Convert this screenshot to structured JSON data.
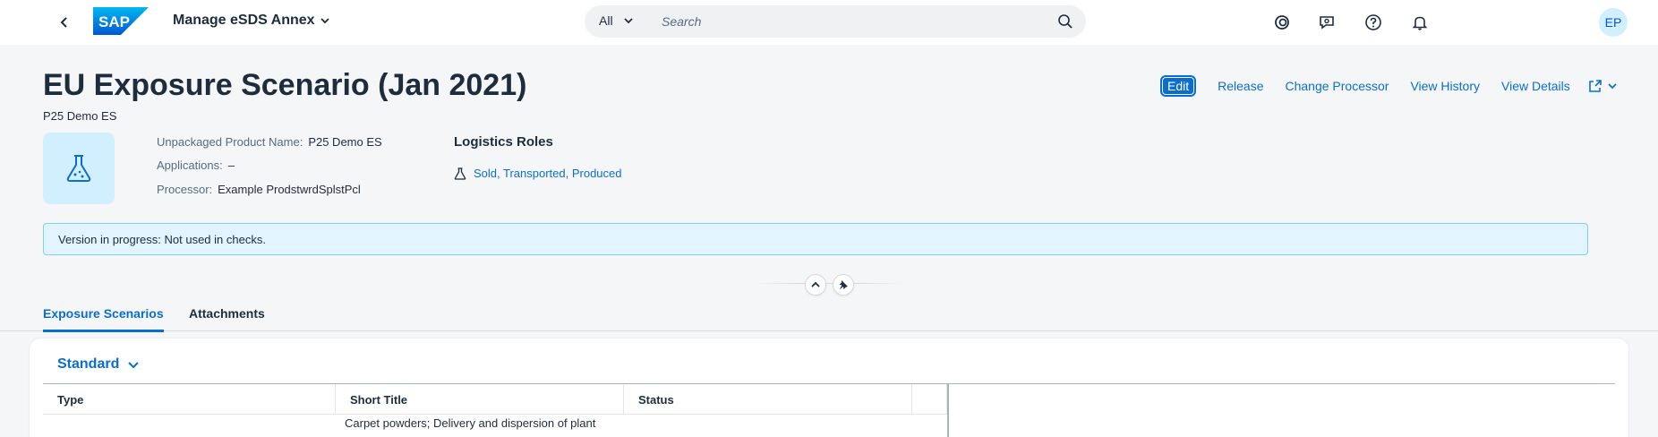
{
  "shell": {
    "app_title": "Manage eSDS Annex",
    "search_scope": "All",
    "search_placeholder": "Search",
    "avatar_initials": "EP"
  },
  "header": {
    "title": "EU Exposure Scenario (Jan 2021)",
    "subtitle": "P25 Demo ES",
    "actions": {
      "edit": "Edit",
      "release": "Release",
      "change_processor": "Change Processor",
      "view_history": "View History",
      "view_details": "View Details"
    },
    "attributes": [
      {
        "label": "Unpackaged Product Name:",
        "value": "P25 Demo ES"
      },
      {
        "label": "Applications:",
        "value": "–"
      },
      {
        "label": "Processor:",
        "value": "Example ProdstwrdSplstPcl"
      }
    ],
    "logistics_roles": {
      "title": "Logistics Roles",
      "value": "Sold, Transported, Produced"
    },
    "info_strip": "Version in progress: Not used in checks."
  },
  "tabs": [
    {
      "label": "Exposure Scenarios",
      "active": true
    },
    {
      "label": "Attachments",
      "active": false
    }
  ],
  "table": {
    "variant": "Standard",
    "columns": [
      "Type",
      "Short Title",
      "Status"
    ],
    "rows": [
      {
        "type": "",
        "short_title": "Carpet powders; Delivery and dispersion of plant",
        "status": ""
      }
    ]
  },
  "colors": {
    "accent": "#0a6ed1",
    "title": "#1d2d3e",
    "info_background": "#e1f4ff",
    "avatar_background": "#d1efff"
  }
}
